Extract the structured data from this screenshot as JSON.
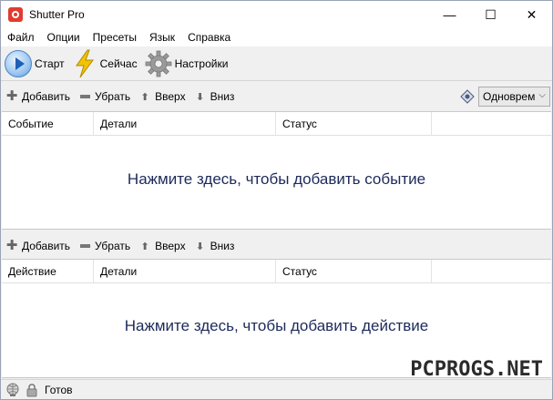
{
  "window": {
    "title": "Shutter Pro",
    "controls": {
      "minimize": "—",
      "maximize": "☐",
      "close": "✕"
    }
  },
  "menu": [
    "Файл",
    "Опции",
    "Пресеты",
    "Язык",
    "Справка"
  ],
  "toolbar": {
    "start_label": "Старт",
    "now_label": "Сейчас",
    "settings_label": "Настройки"
  },
  "events_bar": {
    "add": "Добавить",
    "remove": "Убрать",
    "up": "Вверх",
    "down": "Вниз",
    "mode": "Одноврем"
  },
  "events_list": {
    "columns": [
      "Событие",
      "Детали",
      "Статус",
      ""
    ],
    "empty_hint": "Нажмите здесь, чтобы добавить событие"
  },
  "actions_bar": {
    "add": "Добавить",
    "remove": "Убрать",
    "up": "Вверх",
    "down": "Вниз"
  },
  "actions_list": {
    "columns": [
      "Действие",
      "Детали",
      "Статус",
      ""
    ],
    "empty_hint": "Нажмите здесь, чтобы добавить действие"
  },
  "status": {
    "text": "Готов"
  },
  "watermark": "PCPROGS.NET",
  "colors": {
    "hint_text": "#1d2a5a",
    "app_icon": "#e03c31",
    "start_icon": "#5a96d8",
    "bolt": "#f2c300"
  },
  "icons": [
    "app-icon",
    "start-icon",
    "lightning-icon",
    "gear-icon",
    "plus-icon",
    "minus-icon",
    "arrow-up-icon",
    "arrow-down-icon",
    "mode-icon",
    "chevron-down-icon",
    "web-icon",
    "lock-icon"
  ]
}
